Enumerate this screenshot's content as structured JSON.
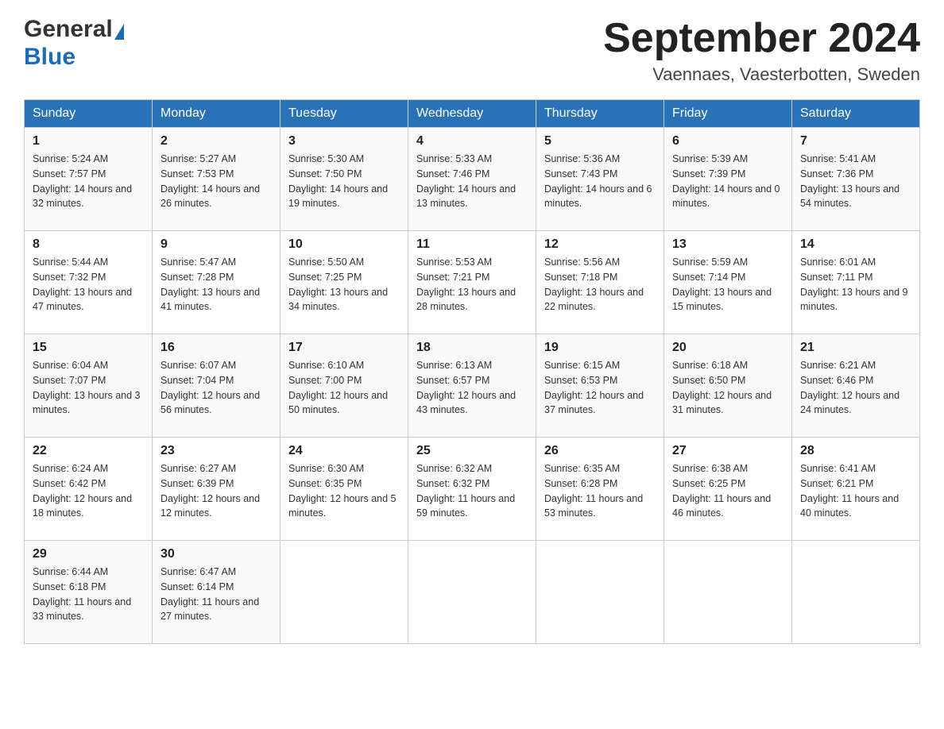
{
  "header": {
    "logo_general": "General",
    "logo_blue": "Blue",
    "month_title": "September 2024",
    "location": "Vaennaes, Vaesterbotten, Sweden"
  },
  "weekdays": [
    "Sunday",
    "Monday",
    "Tuesday",
    "Wednesday",
    "Thursday",
    "Friday",
    "Saturday"
  ],
  "weeks": [
    [
      {
        "day": "1",
        "sunrise": "5:24 AM",
        "sunset": "7:57 PM",
        "daylight": "14 hours and 32 minutes."
      },
      {
        "day": "2",
        "sunrise": "5:27 AM",
        "sunset": "7:53 PM",
        "daylight": "14 hours and 26 minutes."
      },
      {
        "day": "3",
        "sunrise": "5:30 AM",
        "sunset": "7:50 PM",
        "daylight": "14 hours and 19 minutes."
      },
      {
        "day": "4",
        "sunrise": "5:33 AM",
        "sunset": "7:46 PM",
        "daylight": "14 hours and 13 minutes."
      },
      {
        "day": "5",
        "sunrise": "5:36 AM",
        "sunset": "7:43 PM",
        "daylight": "14 hours and 6 minutes."
      },
      {
        "day": "6",
        "sunrise": "5:39 AM",
        "sunset": "7:39 PM",
        "daylight": "14 hours and 0 minutes."
      },
      {
        "day": "7",
        "sunrise": "5:41 AM",
        "sunset": "7:36 PM",
        "daylight": "13 hours and 54 minutes."
      }
    ],
    [
      {
        "day": "8",
        "sunrise": "5:44 AM",
        "sunset": "7:32 PM",
        "daylight": "13 hours and 47 minutes."
      },
      {
        "day": "9",
        "sunrise": "5:47 AM",
        "sunset": "7:28 PM",
        "daylight": "13 hours and 41 minutes."
      },
      {
        "day": "10",
        "sunrise": "5:50 AM",
        "sunset": "7:25 PM",
        "daylight": "13 hours and 34 minutes."
      },
      {
        "day": "11",
        "sunrise": "5:53 AM",
        "sunset": "7:21 PM",
        "daylight": "13 hours and 28 minutes."
      },
      {
        "day": "12",
        "sunrise": "5:56 AM",
        "sunset": "7:18 PM",
        "daylight": "13 hours and 22 minutes."
      },
      {
        "day": "13",
        "sunrise": "5:59 AM",
        "sunset": "7:14 PM",
        "daylight": "13 hours and 15 minutes."
      },
      {
        "day": "14",
        "sunrise": "6:01 AM",
        "sunset": "7:11 PM",
        "daylight": "13 hours and 9 minutes."
      }
    ],
    [
      {
        "day": "15",
        "sunrise": "6:04 AM",
        "sunset": "7:07 PM",
        "daylight": "13 hours and 3 minutes."
      },
      {
        "day": "16",
        "sunrise": "6:07 AM",
        "sunset": "7:04 PM",
        "daylight": "12 hours and 56 minutes."
      },
      {
        "day": "17",
        "sunrise": "6:10 AM",
        "sunset": "7:00 PM",
        "daylight": "12 hours and 50 minutes."
      },
      {
        "day": "18",
        "sunrise": "6:13 AM",
        "sunset": "6:57 PM",
        "daylight": "12 hours and 43 minutes."
      },
      {
        "day": "19",
        "sunrise": "6:15 AM",
        "sunset": "6:53 PM",
        "daylight": "12 hours and 37 minutes."
      },
      {
        "day": "20",
        "sunrise": "6:18 AM",
        "sunset": "6:50 PM",
        "daylight": "12 hours and 31 minutes."
      },
      {
        "day": "21",
        "sunrise": "6:21 AM",
        "sunset": "6:46 PM",
        "daylight": "12 hours and 24 minutes."
      }
    ],
    [
      {
        "day": "22",
        "sunrise": "6:24 AM",
        "sunset": "6:42 PM",
        "daylight": "12 hours and 18 minutes."
      },
      {
        "day": "23",
        "sunrise": "6:27 AM",
        "sunset": "6:39 PM",
        "daylight": "12 hours and 12 minutes."
      },
      {
        "day": "24",
        "sunrise": "6:30 AM",
        "sunset": "6:35 PM",
        "daylight": "12 hours and 5 minutes."
      },
      {
        "day": "25",
        "sunrise": "6:32 AM",
        "sunset": "6:32 PM",
        "daylight": "11 hours and 59 minutes."
      },
      {
        "day": "26",
        "sunrise": "6:35 AM",
        "sunset": "6:28 PM",
        "daylight": "11 hours and 53 minutes."
      },
      {
        "day": "27",
        "sunrise": "6:38 AM",
        "sunset": "6:25 PM",
        "daylight": "11 hours and 46 minutes."
      },
      {
        "day": "28",
        "sunrise": "6:41 AM",
        "sunset": "6:21 PM",
        "daylight": "11 hours and 40 minutes."
      }
    ],
    [
      {
        "day": "29",
        "sunrise": "6:44 AM",
        "sunset": "6:18 PM",
        "daylight": "11 hours and 33 minutes."
      },
      {
        "day": "30",
        "sunrise": "6:47 AM",
        "sunset": "6:14 PM",
        "daylight": "11 hours and 27 minutes."
      },
      null,
      null,
      null,
      null,
      null
    ]
  ],
  "labels": {
    "sunrise": "Sunrise:",
    "sunset": "Sunset:",
    "daylight": "Daylight:"
  }
}
